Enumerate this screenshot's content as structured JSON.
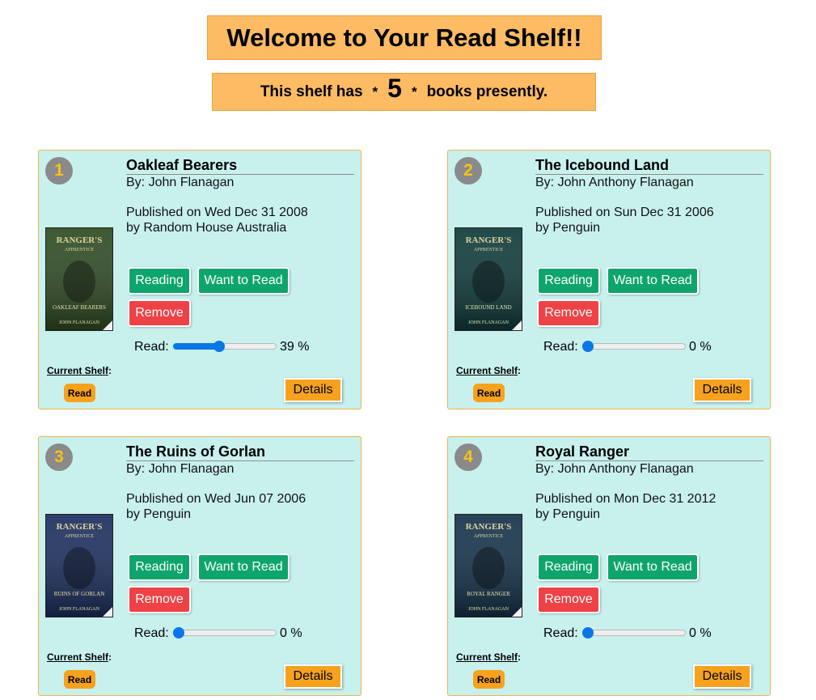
{
  "header": {
    "title": "Welcome to Your Read Shelf!!",
    "count_prefix": "This shelf has",
    "count_sep": "*",
    "count": "5",
    "count_suffix": "books presently."
  },
  "labels": {
    "reading": "Reading",
    "want_to_read": "Want to Read",
    "remove": "Remove",
    "read": "Read:",
    "current_shelf": "Current Shelf",
    "current_shelf_colon": ":",
    "details": "Details"
  },
  "books": [
    {
      "number": "1",
      "title": "Oakleaf Bearers",
      "author": "By: John Flanagan",
      "published": "Published on Wed Dec 31 2008",
      "publisher": "by Random House Australia",
      "progress": 39,
      "progress_text": "39 %",
      "shelf": "Read",
      "cover_text": "OAKLEAF BEARERS",
      "cover_color": "#2e4a22"
    },
    {
      "number": "2",
      "title": "The Icebound Land",
      "author": "By: John Anthony Flanagan",
      "published": "Published on Sun Dec 31 2006",
      "publisher": "by Penguin",
      "progress": 0,
      "progress_text": "0 %",
      "shelf": "Read",
      "cover_text": "ICEBOUND LAND",
      "cover_color": "#0f3a3a"
    },
    {
      "number": "3",
      "title": "The Ruins of Gorlan",
      "author": "By: John Flanagan",
      "published": "Published on Wed Jun 07 2006",
      "publisher": "by Penguin",
      "progress": 0,
      "progress_text": "0 %",
      "shelf": "Read",
      "cover_text": "RUINS OF GORLAN",
      "cover_color": "#1b2e5e"
    },
    {
      "number": "4",
      "title": "Royal Ranger",
      "author": "By: John Anthony Flanagan",
      "published": "Published on Mon Dec 31 2012",
      "publisher": "by Penguin",
      "progress": 0,
      "progress_text": "0 %",
      "shelf": "Read",
      "cover_text": "ROYAL RANGER",
      "cover_color": "#14324a"
    }
  ],
  "colors": {
    "header_bg": "#fdbb63",
    "card_bg": "#c8f1ee",
    "green": "#0ea56d",
    "red": "#ee4246",
    "orange": "#f7a21e",
    "slider": "#0a76e8",
    "badge_number": "#f7c21a"
  }
}
